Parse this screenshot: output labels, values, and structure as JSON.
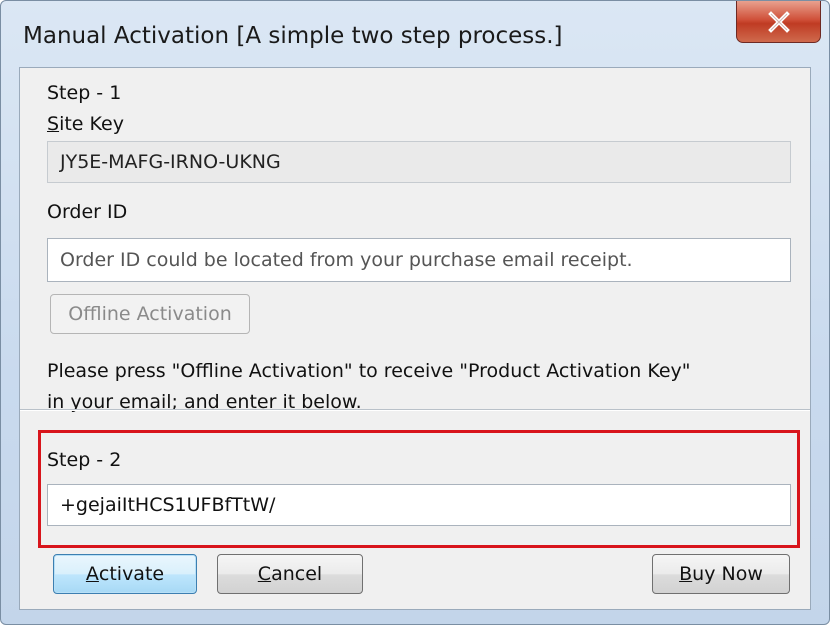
{
  "window": {
    "title": "Manual Activation [A simple two step process.]",
    "close_icon": "close-icon"
  },
  "step1": {
    "heading": "Step - 1",
    "site_key_label": "Site Key",
    "site_key_value": "JY5E-MAFG-IRNO-UKNG",
    "order_id_label": "Order ID",
    "order_id_placeholder": "Order ID could be located from your purchase email receipt.",
    "offline_activation_label": "Offline Activation",
    "instructions_line1": "Please press \"Offline Activation\" to receive \"Product Activation Key\"",
    "instructions_line2": "in your email; and enter it below."
  },
  "step2": {
    "heading": "Step - 2",
    "activation_key_value": "+gejaiItHCS1UFBfTtW/"
  },
  "buttons": {
    "activate_label": "Activate",
    "cancel_label": "Cancel",
    "buy_now_label": "Buy Now"
  },
  "colors": {
    "highlight": "#d8151c",
    "close_button": "#c9472f"
  }
}
